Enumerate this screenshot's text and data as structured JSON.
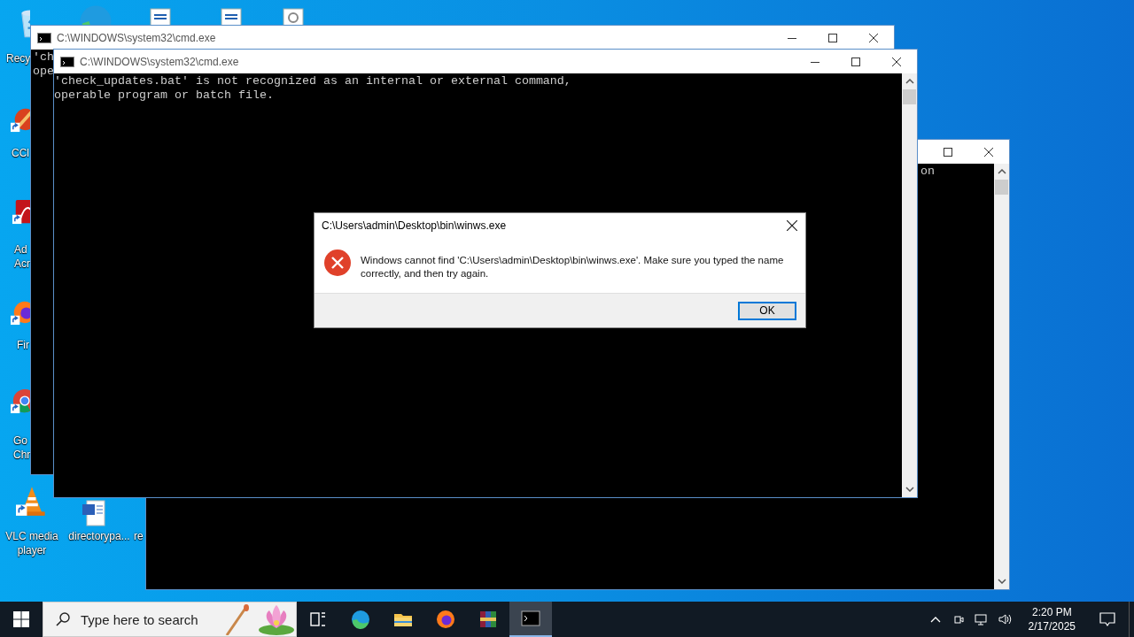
{
  "desktop_icons": [
    {
      "kind": "recycle",
      "label": "Recy"
    },
    {
      "kind": "edge"
    },
    {
      "kind": "document"
    },
    {
      "kind": "document"
    },
    {
      "kind": "settings-document"
    },
    {
      "kind": "ccleaner",
      "label": "CCl",
      "shortcut": true
    },
    {
      "kind": "pdf",
      "label": "Ad Acr",
      "shortcut": true
    },
    {
      "kind": "firefox",
      "label": "Fir",
      "shortcut": true
    },
    {
      "kind": "chrome",
      "label": "Go Chr",
      "shortcut": true
    },
    {
      "kind": "vlc",
      "label": "VLC media player",
      "shortcut": true
    },
    {
      "kind": "word",
      "label": "directorypa..."
    },
    {
      "kind": "hidden",
      "label": "re"
    }
  ],
  "windows": [
    {
      "lines": [
        "on"
      ]
    },
    {
      "title": "C:\\WINDOWS\\system32\\cmd.exe",
      "lines": [
        "'ch",
        "ope"
      ]
    },
    {
      "title": "C:\\WINDOWS\\system32\\cmd.exe",
      "lines": [
        "'check_updates.bat' is not recognized as an internal or external command,",
        "operable program or batch file."
      ]
    }
  ],
  "dialog": {
    "title": "C:\\Users\\admin\\Desktop\\bin\\winws.exe",
    "message": "Windows cannot find 'C:\\Users\\admin\\Desktop\\bin\\winws.exe'. Make sure you typed the name correctly, and then try again.",
    "button": "OK"
  },
  "taskbar": {
    "search": {
      "placeholder": "Type here to search"
    },
    "apps": [
      {
        "kind": "taskview",
        "selected": false
      },
      {
        "kind": "edge",
        "selected": false
      },
      {
        "kind": "explorer",
        "selected": false
      },
      {
        "kind": "firefox",
        "selected": false
      },
      {
        "kind": "winrar",
        "selected": false
      },
      {
        "kind": "cmd",
        "selected": true
      }
    ],
    "time": "2:20 PM",
    "date": "2/17/2025"
  }
}
